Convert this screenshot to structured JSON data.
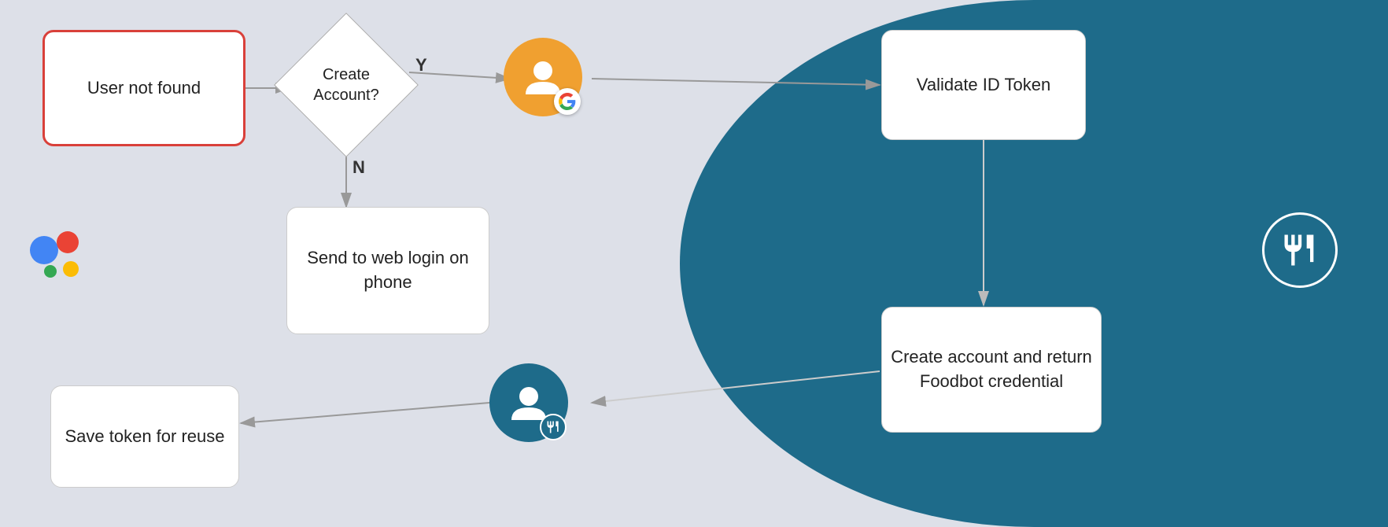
{
  "nodes": {
    "user_not_found": "User not found",
    "create_account": "Create\nAccount?",
    "send_to_web": "Send to web login on phone",
    "validate_id": "Validate ID Token",
    "create_account_return": "Create account and return Foodbot credential",
    "save_token": "Save token for reuse"
  },
  "labels": {
    "yes": "Y",
    "no": "N"
  },
  "colors": {
    "bg_left": "#dde0e8",
    "bg_right": "#1e6b8a",
    "node_error_border": "#d9403a",
    "node_normal_bg": "#ffffff",
    "arrow": "#999999"
  }
}
